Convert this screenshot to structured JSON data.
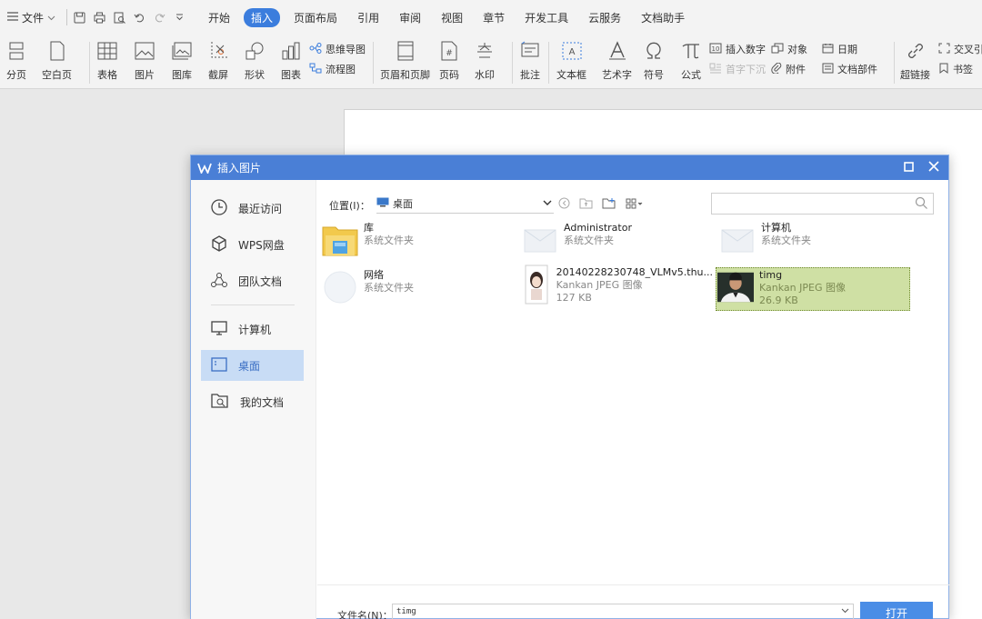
{
  "menubar": {
    "file_label": "文件",
    "tabs": [
      "开始",
      "插入",
      "页面布局",
      "引用",
      "审阅",
      "视图",
      "章节",
      "开发工具",
      "云服务",
      "文档助手"
    ],
    "active_tab": "插入"
  },
  "ribbon": {
    "page_break": "分页",
    "blank_page": "空白页",
    "table": "表格",
    "picture": "图片",
    "gallery": "图库",
    "screenshot": "截屏",
    "shapes": "形状",
    "chart": "图表",
    "mindmap": "思维导图",
    "flowchart": "流程图",
    "header_footer": "页眉和页脚",
    "page_number": "页码",
    "watermark": "水印",
    "comment": "批注",
    "textbox": "文本框",
    "wordart": "艺术字",
    "symbol": "符号",
    "formula": "公式",
    "insert_number": "插入数字",
    "object": "对象",
    "date": "日期",
    "drop_cap": "首字下沉",
    "attachment": "附件",
    "doc_parts": "文档部件",
    "hyperlink": "超链接",
    "cross_ref": "交叉引",
    "bookmark": "书签"
  },
  "dialog": {
    "title": "插入图片",
    "sidebar": [
      "最近访问",
      "WPS网盘",
      "团队文档",
      "计算机",
      "桌面",
      "我的文档"
    ],
    "active_sidebar": "桌面",
    "location_label": "位置(I)：",
    "location_value": "桌面",
    "search_placeholder": "",
    "files": [
      {
        "name": "库",
        "sub1": "系统文件夹",
        "sub2": ""
      },
      {
        "name": "Administrator",
        "sub1": "系统文件夹",
        "sub2": ""
      },
      {
        "name": "计算机",
        "sub1": "系统文件夹",
        "sub2": ""
      },
      {
        "name": "网络",
        "sub1": "系统文件夹",
        "sub2": ""
      },
      {
        "name": "20140228230748_VLMv5.thu...",
        "sub1": "Kankan JPEG 图像",
        "sub2": "127 KB"
      },
      {
        "name": "timg",
        "sub1": "Kankan JPEG 图像",
        "sub2": "26.9 KB"
      }
    ],
    "filename_label": "文件名(N)：",
    "filename_value": "timg",
    "open_button": "打开"
  }
}
